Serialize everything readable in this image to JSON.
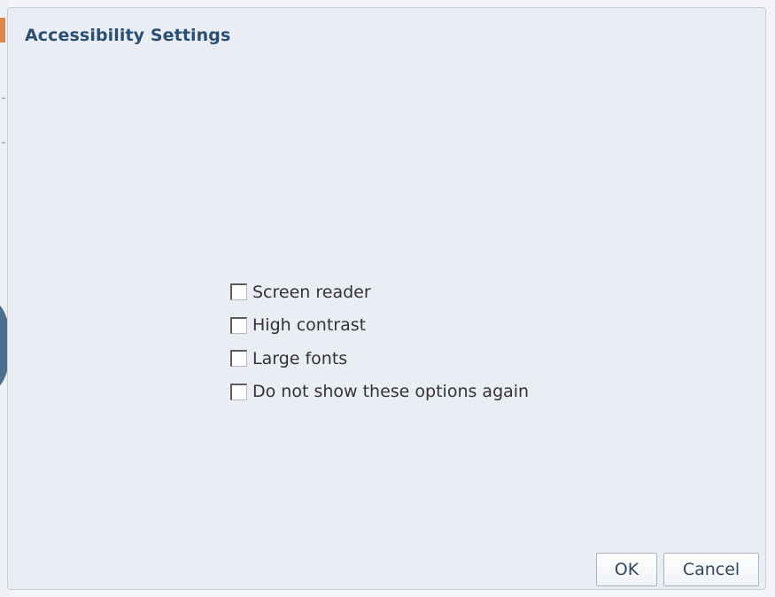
{
  "dialog": {
    "title": "Accessibility Settings"
  },
  "options": [
    {
      "label": "Screen reader",
      "checked": false
    },
    {
      "label": "High contrast",
      "checked": false
    },
    {
      "label": "Large fonts",
      "checked": false
    },
    {
      "label": "Do not show these options again",
      "checked": false
    }
  ],
  "buttons": {
    "ok_label": "OK",
    "cancel_label": "Cancel"
  },
  "colors": {
    "title": "#2a4f74",
    "dialog_background": "#eaedf4",
    "text": "#333333"
  }
}
